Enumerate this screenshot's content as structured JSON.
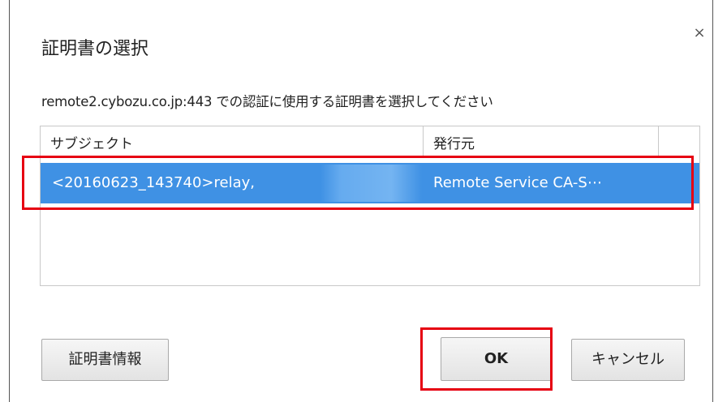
{
  "dialog": {
    "title": "証明書の選択",
    "close_label": "×",
    "message": "remote2.cybozu.co.jp:443 での認証に使用する証明書を選択してください"
  },
  "table": {
    "headers": {
      "subject": "サブジェクト",
      "issuer": "発行元"
    },
    "rows": [
      {
        "subject": "<20160623_143740>relay,",
        "issuer": "Remote Service CA-S⋯",
        "selected": true
      }
    ]
  },
  "buttons": {
    "certificate_info": "証明書情報",
    "ok": "OK",
    "cancel": "キャンセル"
  },
  "colors": {
    "selection": "#3f91e4",
    "annotation": "#e60012"
  }
}
